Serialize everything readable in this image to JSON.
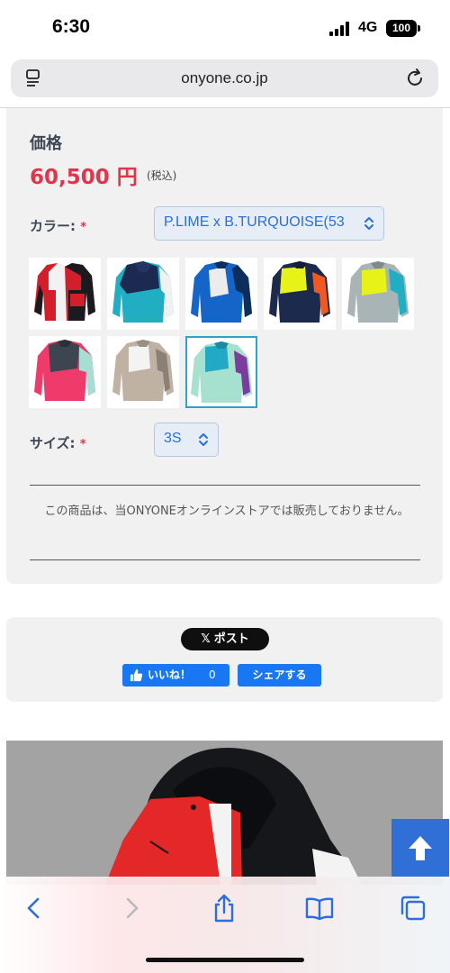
{
  "status_bar": {
    "time": "6:30",
    "network": "4G",
    "battery": "100"
  },
  "browser": {
    "url": "onyone.co.jp"
  },
  "product": {
    "price_label": "価格",
    "price": "60,500 円",
    "tax_note": "(税込)",
    "color_label": "カラー:",
    "required_mark": "*",
    "color_value": "P.LIME x B.TURQUOISE(53",
    "size_label": "サイズ:",
    "size_value": "3S",
    "notice": "この商品は、当ONYONEオンラインストアでは販売しておりません。",
    "swatches": [
      {
        "name": "red-black-white"
      },
      {
        "name": "navy-turquoise"
      },
      {
        "name": "blue-white"
      },
      {
        "name": "lime-navy-orange"
      },
      {
        "name": "lime-grey-turquoise"
      },
      {
        "name": "pink-charcoal-mint"
      },
      {
        "name": "beige-white"
      },
      {
        "name": "turquoise-mint-purple",
        "selected": true
      }
    ]
  },
  "share": {
    "x_logo": "𝕏",
    "x_post": "ポスト",
    "like_label": "いいね！",
    "like_count": "0",
    "facebook_share": "シェアする"
  },
  "toolbar": {
    "icons": [
      "back-icon",
      "forward-icon",
      "share-icon",
      "bookmarks-icon",
      "tabs-icon"
    ]
  }
}
